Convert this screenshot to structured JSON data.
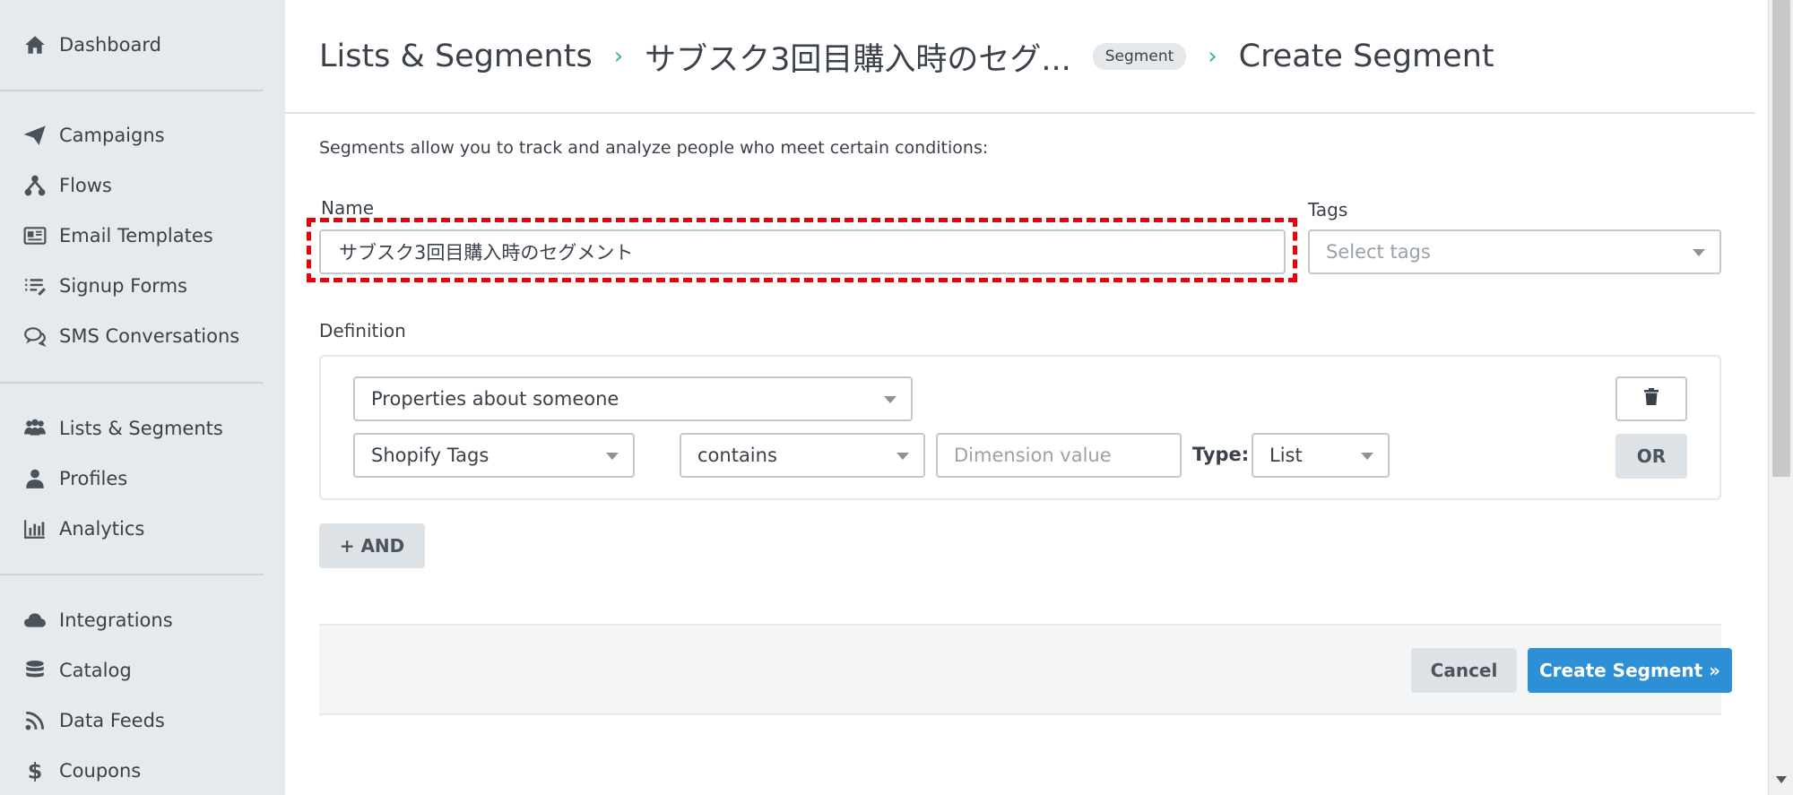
{
  "sidebar": {
    "items": [
      {
        "label": "Dashboard",
        "icon": "home-icon"
      },
      {
        "label": "Campaigns",
        "icon": "paper-plane-icon"
      },
      {
        "label": "Flows",
        "icon": "flow-icon"
      },
      {
        "label": "Email Templates",
        "icon": "email-template-icon"
      },
      {
        "label": "Signup Forms",
        "icon": "list-form-icon"
      },
      {
        "label": "SMS Conversations",
        "icon": "chat-bubbles-icon"
      },
      {
        "label": "Lists & Segments",
        "icon": "people-icon"
      },
      {
        "label": "Profiles",
        "icon": "person-icon"
      },
      {
        "label": "Analytics",
        "icon": "bar-chart-icon"
      },
      {
        "label": "Integrations",
        "icon": "cloud-icon"
      },
      {
        "label": "Catalog",
        "icon": "database-icon"
      },
      {
        "label": "Data Feeds",
        "icon": "rss-icon"
      },
      {
        "label": "Coupons",
        "icon": "dollar-icon"
      }
    ]
  },
  "header": {
    "crumb_lists": "Lists & Segments",
    "crumb_segment": "サブスク3回目購入時のセグ...",
    "badge": "Segment",
    "crumb_current": "Create Segment",
    "separator": "›"
  },
  "form": {
    "intro": "Segments allow you to track and analyze people who meet certain conditions:",
    "name_label": "Name",
    "name_value": "サブスク3回目購入時のセグメント",
    "tags_label": "Tags",
    "tags_placeholder": "Select tags",
    "definition_label": "Definition"
  },
  "definition": {
    "condition_type": "Properties about someone",
    "property": "Shopify Tags",
    "operator": "contains",
    "value_placeholder": "Dimension value",
    "type_label": "Type:",
    "type_value": "List",
    "or_label": "OR",
    "and_label": "+ AND"
  },
  "footer": {
    "cancel_label": "Cancel",
    "create_label": "Create Segment »"
  },
  "colors": {
    "accent": "#2d8fd6",
    "separator": "#2fbf71",
    "highlight": "#e8000c",
    "sidebar_bg": "#e6eaed"
  }
}
